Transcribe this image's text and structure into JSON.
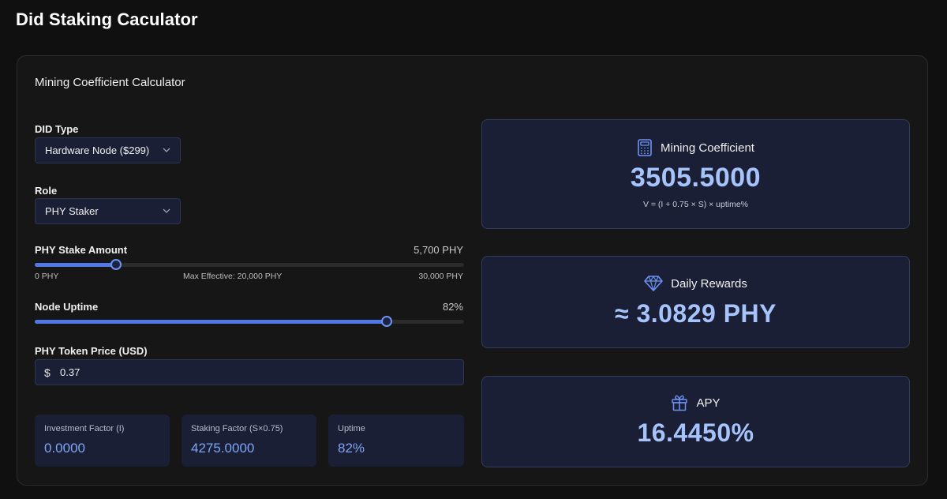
{
  "app": {
    "title": "Did Staking Caculator"
  },
  "card": {
    "title": "Mining Coefficient Calculator"
  },
  "did_type": {
    "label": "DID Type",
    "selected": "Hardware Node ($299)"
  },
  "role": {
    "label": "Role",
    "selected": "PHY Staker"
  },
  "stake": {
    "label": "PHY Stake Amount",
    "value_text": "5,700 PHY",
    "min_label": "0 PHY",
    "mid_label": "Max Effective: 20,000 PHY",
    "max_label": "30,000 PHY",
    "value": 5700,
    "min": 0,
    "max": 30000
  },
  "uptime": {
    "label": "Node Uptime",
    "value_text": "82%",
    "value": 82,
    "min": 0,
    "max": 100
  },
  "price": {
    "label": "PHY Token Price (USD)",
    "currency": "$",
    "value": "0.37"
  },
  "stats": [
    {
      "label": "Investment Factor (I)",
      "value": "0.0000"
    },
    {
      "label": "Staking Factor (S×0.75)",
      "value": "4275.0000"
    },
    {
      "label": "Uptime",
      "value": "82%"
    }
  ],
  "results": {
    "mining": {
      "title": "Mining Coefficient",
      "value": "3505.5000",
      "formula": "V = (I + 0.75 × S) × uptime%",
      "icon": "calculator-icon"
    },
    "daily": {
      "title": "Daily Rewards",
      "value": "≈ 3.0829 PHY",
      "icon": "diamond-icon"
    },
    "apy": {
      "title": "APY",
      "value": "16.4450%",
      "icon": "gift-icon"
    }
  },
  "colors": {
    "accent": "#4f78e6",
    "panel": "#1a1f35",
    "highlight": "#a6c3fb"
  }
}
